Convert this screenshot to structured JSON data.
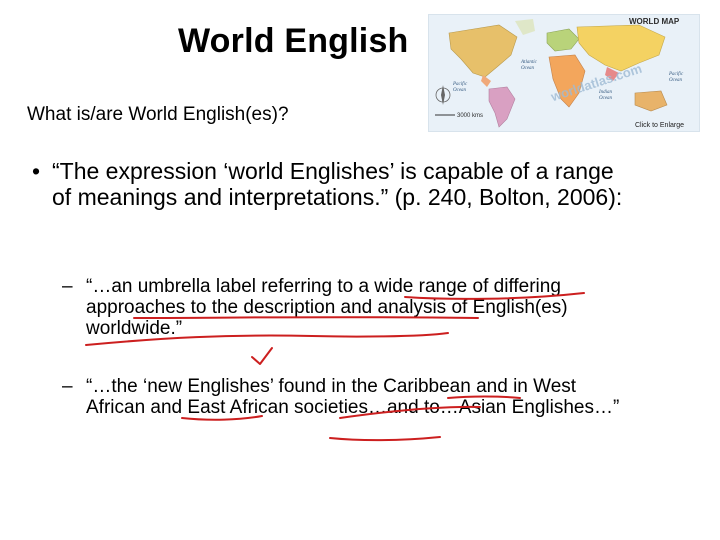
{
  "slide": {
    "title": "World English",
    "subtitle": "What is/are World English(es)?",
    "bullet": {
      "marker": "•",
      "text": "“The expression ‘world Englishes’ is capable of a range of meanings and interpretations.” (p. 240, Bolton, 2006):"
    },
    "sub_bullets": [
      {
        "marker": "–",
        "text": "“…an umbrella label referring to a wide range of differing approaches to the description and analysis of English(es) worldwide.”"
      },
      {
        "marker": "–",
        "text": "“…the ‘new Englishes’ found in the Caribbean and in West African and East African societies…and to…Asian Englishes…”"
      }
    ]
  },
  "world_map": {
    "heading": "WORLD MAP",
    "scale": "3000 kms",
    "enlarge_link": "Click to Enlarge",
    "watermark": "worldatlas.com",
    "ocean_labels": [
      "Atlantic Ocean",
      "Pacific Ocean",
      "Indian Ocean",
      "Pacific Ocean"
    ]
  },
  "annotation_color": "#cc1f1f"
}
